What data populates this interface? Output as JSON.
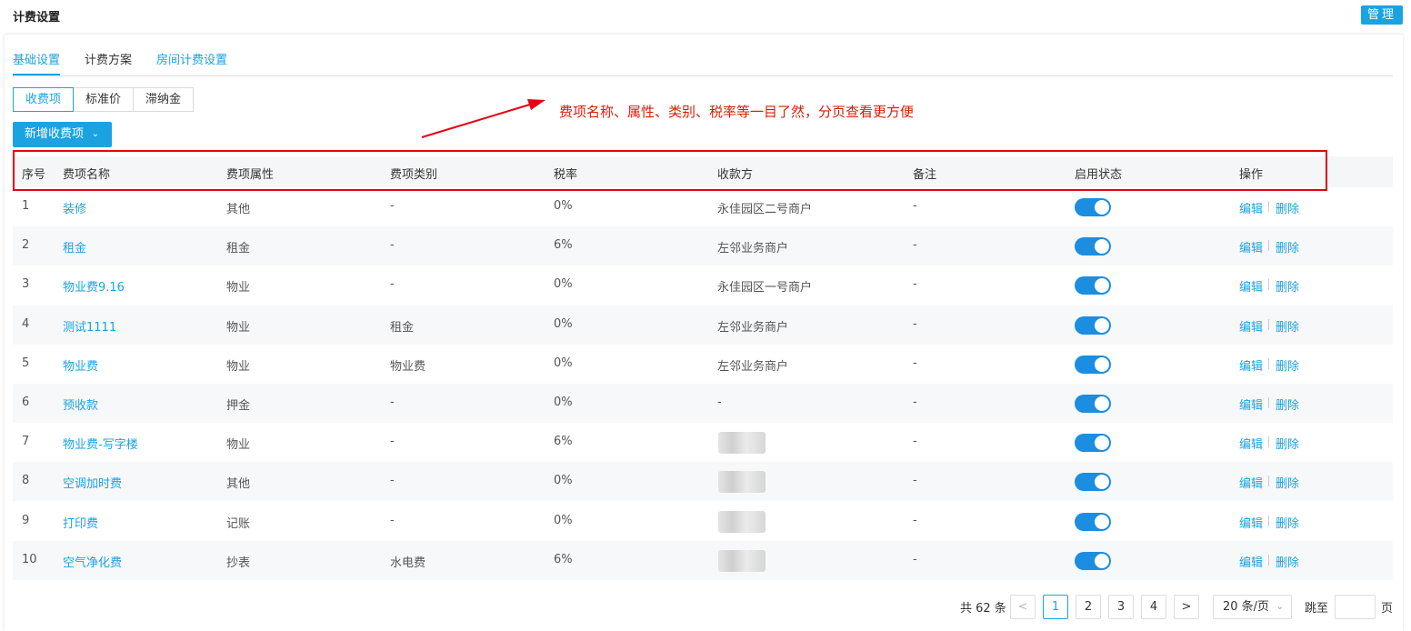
{
  "header": {
    "title": "计费设置",
    "manage_label": "管理"
  },
  "tabs": [
    {
      "label": "基础设置",
      "active": true
    },
    {
      "label": "计费方案",
      "active": false
    },
    {
      "label": "房间计费设置",
      "active": false
    }
  ],
  "subtabs": [
    "收费项",
    "标准价",
    "滞纳金"
  ],
  "add_button": {
    "label": "新增收费项",
    "icon": "chevron-down-icon"
  },
  "annotation": {
    "text": "费项名称、属性、类别、税率等一目了然，分页查看更方便",
    "color": "#d81e06"
  },
  "columns": [
    "序号",
    "费项名称",
    "费项属性",
    "费项类别",
    "税率",
    "收款方",
    "备注",
    "启用状态",
    "操作"
  ],
  "rows": [
    {
      "no": "1",
      "name": "装修",
      "attr": "其他",
      "category": "-",
      "tax": "0%",
      "payee": "永佳园区二号商户",
      "payee_blurred": false,
      "remark": "-",
      "enabled": true
    },
    {
      "no": "2",
      "name": "租金",
      "attr": "租金",
      "category": "-",
      "tax": "6%",
      "payee": "左邻业务商户",
      "payee_blurred": false,
      "remark": "-",
      "enabled": true
    },
    {
      "no": "3",
      "name": "物业费9.16",
      "attr": "物业",
      "category": "-",
      "tax": "0%",
      "payee": "永佳园区一号商户",
      "payee_blurred": false,
      "remark": "-",
      "enabled": true
    },
    {
      "no": "4",
      "name": "测试1111",
      "attr": "物业",
      "category": "租金",
      "tax": "0%",
      "payee": "左邻业务商户",
      "payee_blurred": false,
      "remark": "-",
      "enabled": true
    },
    {
      "no": "5",
      "name": "物业费",
      "attr": "物业",
      "category": "物业费",
      "tax": "0%",
      "payee": "左邻业务商户",
      "payee_blurred": false,
      "remark": "-",
      "enabled": true
    },
    {
      "no": "6",
      "name": "预收款",
      "attr": "押金",
      "category": "-",
      "tax": "0%",
      "payee": "-",
      "payee_blurred": false,
      "remark": "-",
      "enabled": true
    },
    {
      "no": "7",
      "name": "物业费-写字楼",
      "attr": "物业",
      "category": "-",
      "tax": "6%",
      "payee": "",
      "payee_blurred": true,
      "remark": "-",
      "enabled": true
    },
    {
      "no": "8",
      "name": "空调加时费",
      "attr": "其他",
      "category": "-",
      "tax": "0%",
      "payee": "",
      "payee_blurred": true,
      "remark": "-",
      "enabled": true
    },
    {
      "no": "9",
      "name": "打印费",
      "attr": "记账",
      "category": "-",
      "tax": "0%",
      "payee": "",
      "payee_blurred": true,
      "remark": "-",
      "enabled": true
    },
    {
      "no": "10",
      "name": "空气净化费",
      "attr": "抄表",
      "category": "水电费",
      "tax": "6%",
      "payee": "",
      "payee_blurred": true,
      "remark": "-",
      "enabled": true
    }
  ],
  "actions": {
    "edit": "编辑",
    "delete": "删除"
  },
  "pagination": {
    "total": "共 62 条",
    "prev": "<",
    "pages": [
      "1",
      "2",
      "3",
      "4"
    ],
    "current": "1",
    "next": ">",
    "page_size": "20 条/页",
    "jump_label": "跳至",
    "page_unit": "页"
  },
  "colors": {
    "accent": "#1ba3e1",
    "toggle_on": "#1b8ee1",
    "highlight": "#e60012"
  }
}
